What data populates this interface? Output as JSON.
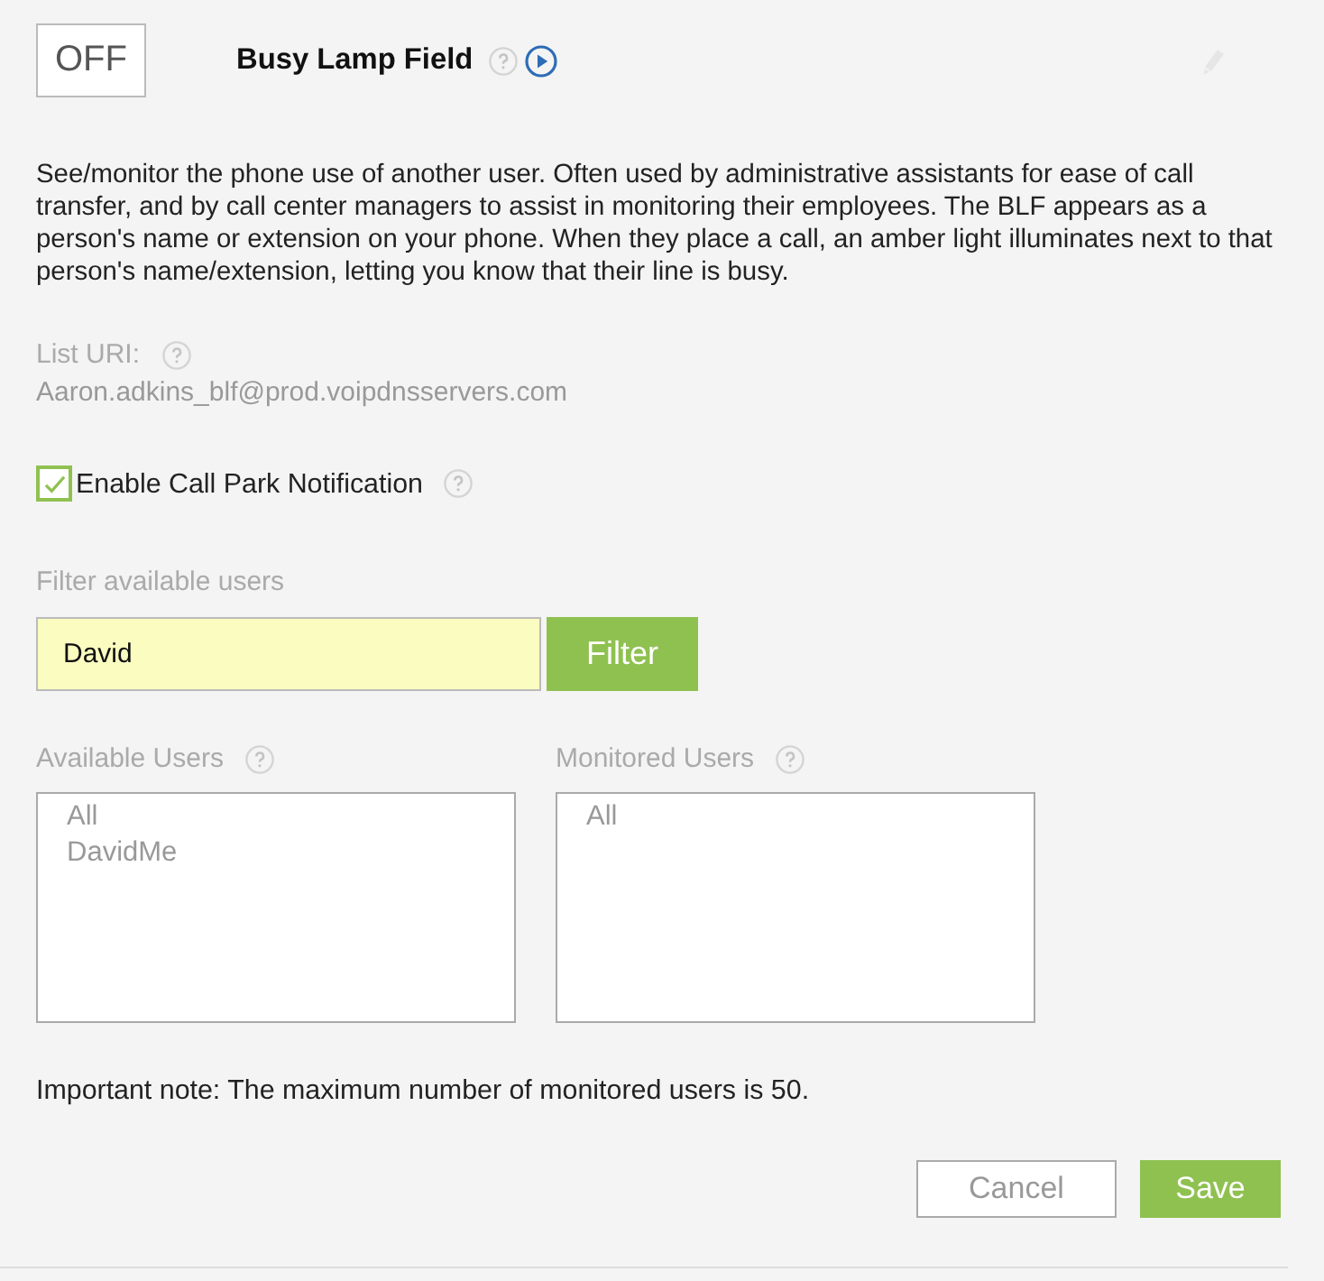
{
  "toggle": {
    "label": "OFF",
    "on": false
  },
  "header": {
    "title": "Busy Lamp Field"
  },
  "description": "See/monitor the phone use of another user. Often used by administrative assistants for ease of call transfer, and by call center managers to assist in monitoring their employees. The BLF appears as a person's name or extension on your phone. When they place a call, an amber light illuminates next to that person's name/extension, letting you know that their line is busy.",
  "list_uri": {
    "label": "List URI:",
    "value": "Aaron.adkins_blf@prod.voipdnsservers.com"
  },
  "call_park": {
    "label": "Enable Call Park Notification",
    "checked": true
  },
  "filter": {
    "label": "Filter available users",
    "value": "David",
    "button": "Filter"
  },
  "lists": [
    {
      "label": "Available Users",
      "items": [
        "All",
        "DavidMe"
      ]
    },
    {
      "label": "Monitored Users",
      "items": [
        "All"
      ]
    }
  ],
  "note": "Important note: The maximum number of monitored users is 50.",
  "buttons": [
    {
      "label": "Cancel",
      "kind": "secondary"
    },
    {
      "label": "Save",
      "kind": "primary"
    }
  ]
}
